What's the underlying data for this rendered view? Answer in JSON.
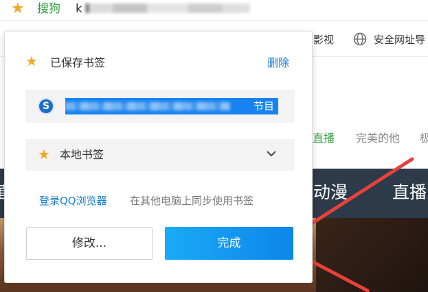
{
  "browser": {
    "site_name": "搜狗",
    "url_prefix": "k"
  },
  "favorites_bar": {
    "items": [
      {
        "label": "影视"
      },
      {
        "label": "安全网址导"
      }
    ]
  },
  "background_page": {
    "nav": [
      "直播",
      "完美的他",
      "极"
    ],
    "band": [
      "直",
      "动漫",
      "直播"
    ]
  },
  "popup": {
    "title": "已保存书签",
    "delete_label": "删除",
    "bookmark_name_suffix": "节目",
    "folder_label": "本地书签",
    "login_link": "登录QQ浏览器",
    "sync_tip": "在其他电脑上同步使用书签",
    "edit_label": "修改...",
    "done_label": "完成"
  },
  "colors": {
    "accent_blue": "#1a7fd5",
    "star_orange": "#f5a623",
    "done_button": "#0c86ea",
    "arrow_red": "#e8413c"
  },
  "icons": [
    "star-icon",
    "globe-icon",
    "sogou-icon",
    "chevron-down-icon"
  ]
}
